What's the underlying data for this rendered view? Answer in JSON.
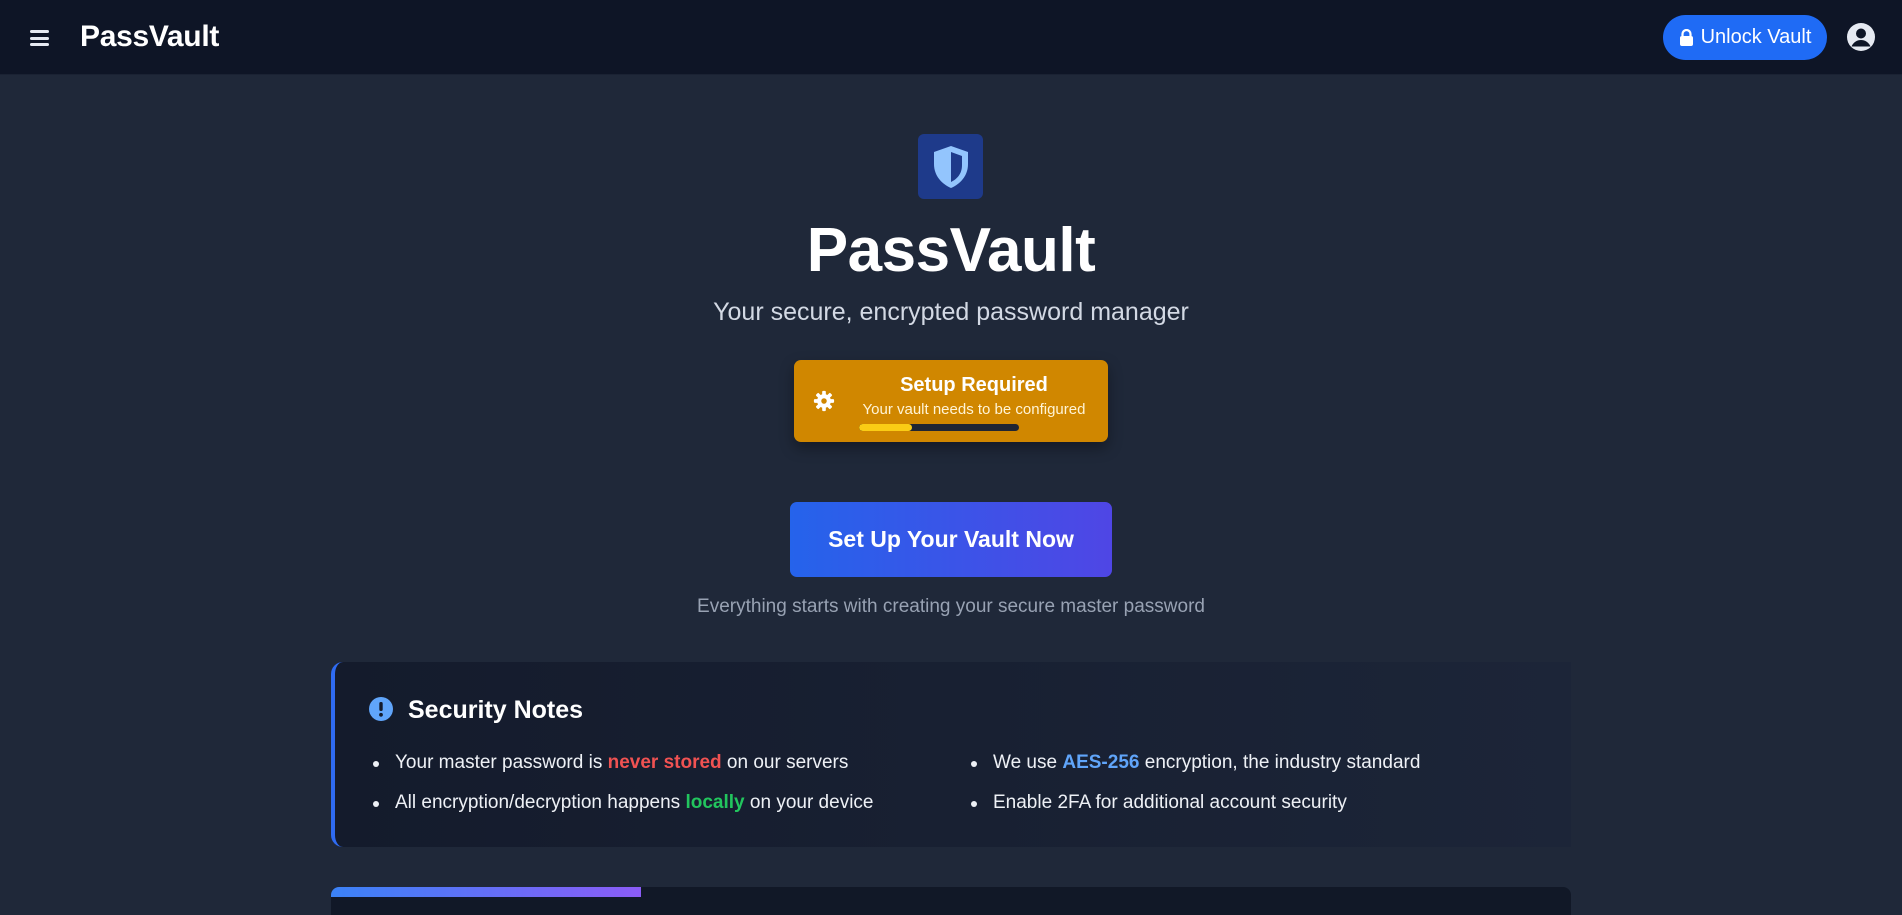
{
  "header": {
    "brand": "PassVault",
    "unlock_label": "Unlock Vault",
    "menu_icon": "hamburger-menu-icon",
    "avatar_icon": "user-circle-icon"
  },
  "hero": {
    "logo_icon": "shield-icon",
    "title": "PassVault",
    "subtitle": "Your secure, encrypted password manager"
  },
  "setup_card": {
    "icon": "gear-icon",
    "title": "Setup Required",
    "description": "Your vault needs to be configured",
    "progress": 0.33
  },
  "cta": {
    "label": "Set Up Your Vault Now",
    "note": "Everything starts with creating your secure master password"
  },
  "security_notes": {
    "icon": "exclamation-circle-icon",
    "title": "Security Notes",
    "items": [
      {
        "before": "Your master password is ",
        "highlight": "never stored",
        "after": " on our servers"
      },
      {
        "before": "All encryption/decryption happens ",
        "highlight": "locally",
        "after": " on your device"
      },
      {
        "before": "We use ",
        "highlight": "AES-256",
        "after": " encryption, the industry standard"
      },
      {
        "text": "Enable 2FA for additional account security"
      }
    ]
  },
  "colors": {
    "page_bg": "#1f2839",
    "topbar_bg": "#0e1526",
    "accent_blue": "#1f6bf5",
    "warning_orange": "#d08700",
    "progress_yellow": "#facc15",
    "highlight_red": "#f05252",
    "highlight_green": "#22c55e",
    "highlight_blue": "#60a5fa"
  }
}
